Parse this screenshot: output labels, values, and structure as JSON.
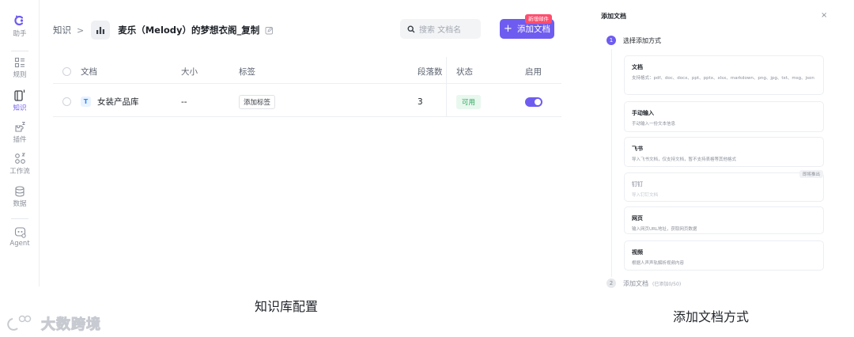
{
  "nav": {
    "items": [
      {
        "label": "助手",
        "icon": "assistant-icon"
      },
      {
        "label": "规则",
        "icon": "rules-icon"
      },
      {
        "label": "知识",
        "icon": "knowledge-icon",
        "active": true
      },
      {
        "label": "插件",
        "icon": "plugin-icon"
      },
      {
        "label": "工作流",
        "icon": "workflow-icon"
      },
      {
        "label": "数据",
        "icon": "database-icon"
      },
      {
        "label": "Agent",
        "icon": "agent-icon"
      }
    ]
  },
  "header": {
    "breadcrumb_root": "知识",
    "breadcrumb_sep": ">",
    "title": "麦乐（Melody）的梦想衣阁_复制",
    "search_placeholder": "搜索 文档名",
    "add_button_label": "添加文档",
    "add_button_plus": "+",
    "new_badge": "新增邮件"
  },
  "table": {
    "columns": [
      "文档",
      "大小",
      "标签",
      "段落数",
      "状态",
      "启用"
    ],
    "rows": [
      {
        "type_icon": "T",
        "name": "女装产品库",
        "size": "--",
        "tag_action": "添加标签",
        "paragraphs": "3",
        "status": "可用",
        "enabled": true
      }
    ]
  },
  "captions": {
    "left": "知识库配置",
    "right": "添加文档方式"
  },
  "watermark": "大数跨境",
  "drawer": {
    "title": "添加文档",
    "close": "×",
    "step1": {
      "num": "1",
      "label": "选择添加方式"
    },
    "options": [
      {
        "title": "文档",
        "desc": "支持格式：pdf、doc、docx、ppt、pptx、xlsx、markdown、png、jpg、txt、msg、json"
      },
      {
        "title": "手动输入",
        "desc": "手动输入一份文本信息"
      },
      {
        "title": "飞书",
        "desc": "导入飞书文档，仅支持文档，暂不支持表格等其他格式"
      },
      {
        "title": "钉钉",
        "desc": "导入钉钉文档",
        "badge": "即将推出",
        "disabled": true
      },
      {
        "title": "网页",
        "desc": "输入网页URL地址，获取网页数据"
      },
      {
        "title": "视频",
        "desc": "根据人声声轨解析视频内容"
      }
    ],
    "step2": {
      "num": "2",
      "label": "添加文档",
      "sub": "(已添加0/50)"
    }
  },
  "colors": {
    "accent": "#6e5cf0",
    "badge": "#ff4d6d",
    "status_green": "#2ea660"
  }
}
